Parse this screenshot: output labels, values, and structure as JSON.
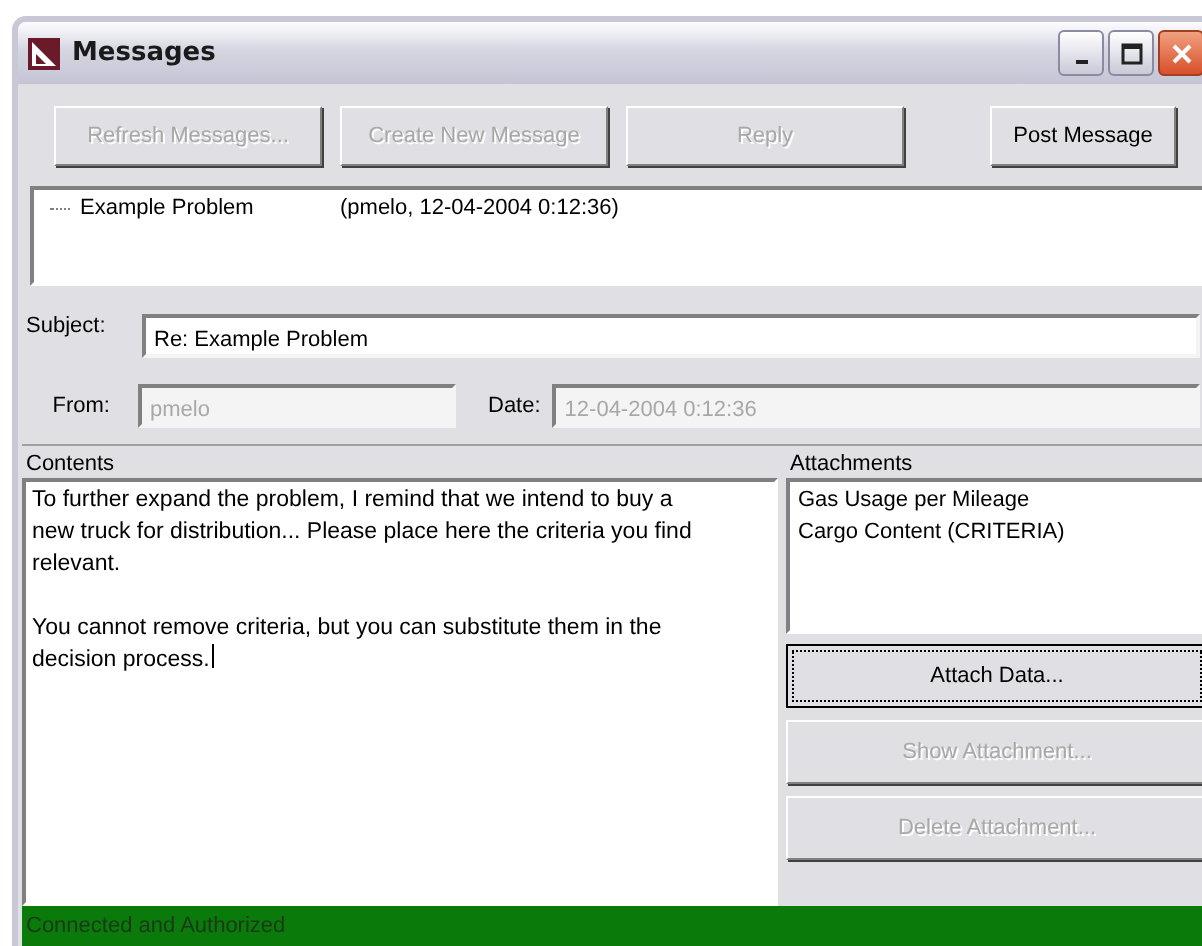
{
  "window": {
    "title": "Messages"
  },
  "toolbar": [
    {
      "label": "Refresh Messages...",
      "disabled": true
    },
    {
      "label": "Create New Message",
      "disabled": true
    },
    {
      "label": "Reply",
      "disabled": true
    },
    {
      "label": "Post Message",
      "disabled": false
    }
  ],
  "messages": [
    {
      "title": "Example Problem",
      "meta": "(pmelo, 12-04-2004 0:12:36)"
    }
  ],
  "subject": {
    "label": "Subject:",
    "value": "Re: Example Problem",
    "disabled": false
  },
  "from": {
    "label": "From:",
    "value": "pmelo",
    "disabled": true
  },
  "date": {
    "label": "Date:",
    "value": "12-04-2004 0:12:36",
    "disabled": true
  },
  "contents": {
    "label": "Contents",
    "paragraphs": [
      "To further expand the problem, I remind that we intend to buy a new truck for distribution... Please place here the criteria you find relevant.",
      "You cannot remove criteria, but you can substitute them in the decision process."
    ]
  },
  "attachments": {
    "label": "Attachments",
    "items": [
      "Gas Usage per Mileage",
      "Cargo Content (CRITERIA)"
    ],
    "buttons": [
      {
        "label": "Attach Data...",
        "disabled": false,
        "focused": true
      },
      {
        "label": "Show Attachment...",
        "disabled": true,
        "focused": false
      },
      {
        "label": "Delete Attachment...",
        "disabled": true,
        "focused": false
      }
    ]
  },
  "status_bar": {
    "text": "Connected and Authorized"
  }
}
